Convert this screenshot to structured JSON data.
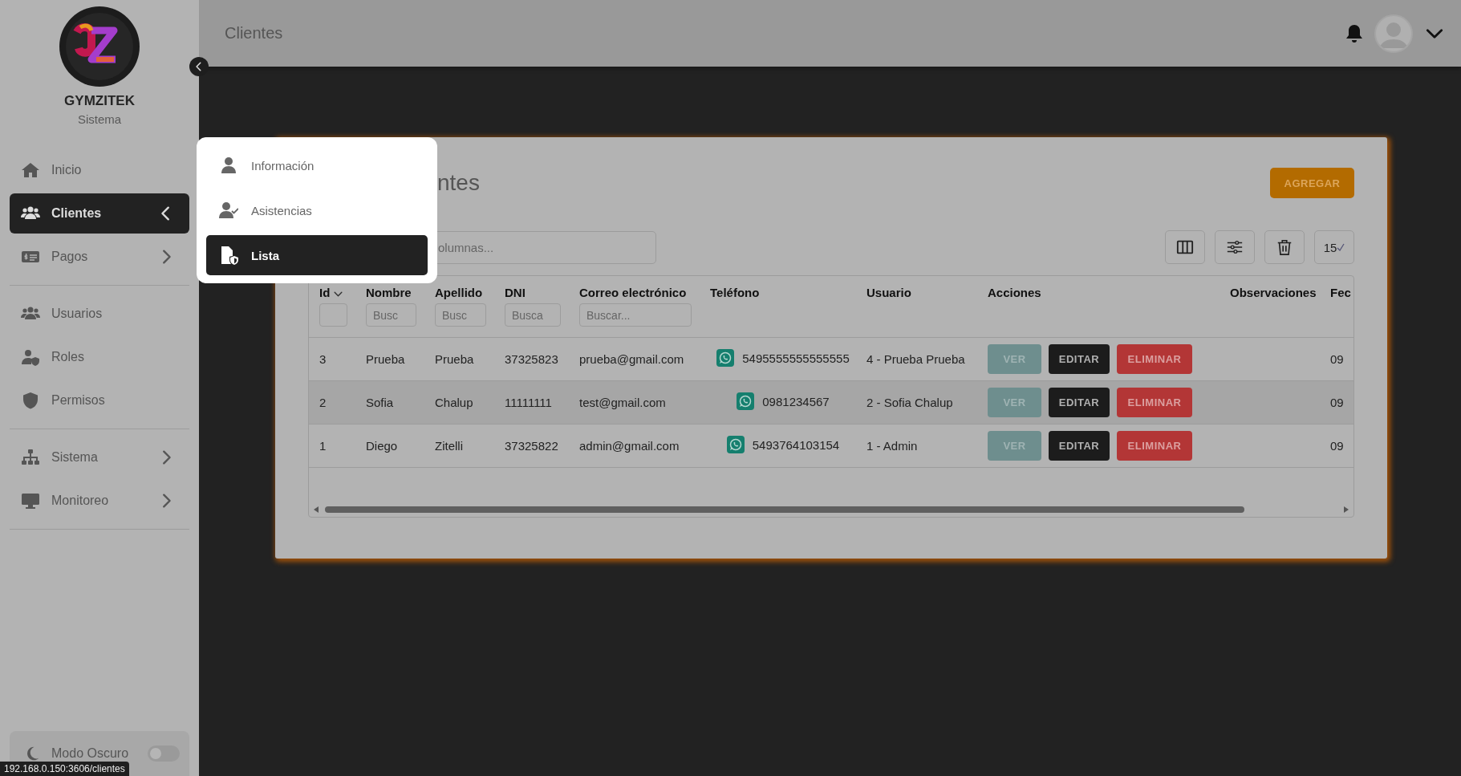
{
  "sidebar": {
    "brand": "GYMZITEK",
    "subtitle": "Sistema",
    "sections": [
      {
        "items": [
          {
            "label": "Inicio",
            "selected": false
          },
          {
            "label": "Clientes",
            "selected": true,
            "expanded": true
          },
          {
            "label": "Pagos",
            "selected": false,
            "expanded": false
          }
        ]
      },
      {
        "items": [
          {
            "label": "Usuarios",
            "selected": false
          },
          {
            "label": "Roles",
            "selected": false
          },
          {
            "label": "Permisos",
            "selected": false
          }
        ]
      },
      {
        "items": [
          {
            "label": "Sistema",
            "selected": false,
            "expanded": false
          },
          {
            "label": "Monitoreo",
            "selected": false,
            "expanded": false
          }
        ]
      }
    ],
    "dark_mode": {
      "label": "Modo Oscuro",
      "on": false
    }
  },
  "topbar": {
    "title": "Clientes"
  },
  "submenu": {
    "items": [
      {
        "label": "Información",
        "selected": false
      },
      {
        "label": "Asistencias",
        "selected": false
      },
      {
        "label": "Lista",
        "selected": true
      }
    ]
  },
  "card": {
    "title": "ntes",
    "add_button": "AGREGAR",
    "search": {
      "placeholder": "olumnas..."
    },
    "page_size": "15",
    "table": {
      "columns": [
        {
          "label": "Id",
          "sorted": true
        },
        {
          "label": "Nombre",
          "sorted": false,
          "filter_placeholder": "Busc"
        },
        {
          "label": "Apellido",
          "sorted": false,
          "filter_placeholder": "Busc"
        },
        {
          "label": "DNI",
          "sorted": false,
          "filter_placeholder": "Busca"
        },
        {
          "label": "Correo electrónico",
          "sorted": false,
          "filter_placeholder": "Buscar..."
        },
        {
          "label": "Teléfono",
          "sorted": false
        },
        {
          "label": "Usuario",
          "sorted": false
        },
        {
          "label": "Acciones",
          "sorted": false
        },
        {
          "label": "Observaciones",
          "sorted": false
        },
        {
          "label": "Fec",
          "sorted": false
        }
      ],
      "rows": [
        {
          "highlighted": false,
          "cells": [
            "3",
            "Prueba",
            "Prueba",
            "37325823",
            "prueba@gmail.com",
            "5495555555555555",
            "4 - Prueba Prueba"
          ],
          "actions": [
            {
              "label": "VER",
              "kind": "view"
            },
            {
              "label": "EDITAR",
              "kind": "edit"
            },
            {
              "label": "ELIMINAR",
              "kind": "delete"
            }
          ],
          "date": "09"
        },
        {
          "highlighted": true,
          "cells": [
            "2",
            "Sofia",
            "Chalup",
            "11111111",
            "test@gmail.com",
            "0981234567",
            "2 - Sofia Chalup"
          ],
          "actions": [
            {
              "label": "VER",
              "kind": "view"
            },
            {
              "label": "EDITAR",
              "kind": "edit"
            },
            {
              "label": "ELIMINAR",
              "kind": "delete"
            }
          ],
          "date": "09"
        },
        {
          "highlighted": false,
          "cells": [
            "1",
            "Diego",
            "Zitelli",
            "37325822",
            "admin@gmail.com",
            "5493764103154",
            "1 - Admin"
          ],
          "actions": [
            {
              "label": "VER",
              "kind": "view"
            },
            {
              "label": "EDITAR",
              "kind": "edit"
            },
            {
              "label": "ELIMINAR",
              "kind": "delete"
            }
          ],
          "date": "09"
        }
      ]
    }
  },
  "status_url": "192.168.0.150:3606/clientes"
}
